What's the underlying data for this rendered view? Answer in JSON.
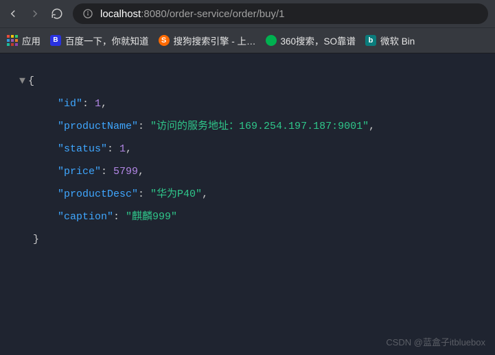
{
  "url": {
    "host": "localhost",
    "rest": ":8080/order-service/order/buy/1"
  },
  "bookmarks": {
    "apps": "应用",
    "baidu": "百度一下，你就知道",
    "sogou": "搜狗搜索引擎 - 上…",
    "d360": "360搜索，SO靠谱",
    "bing": "微软 Bin"
  },
  "json": {
    "keys": {
      "id": "\"id\"",
      "productName": "\"productName\"",
      "status": "\"status\"",
      "price": "\"price\"",
      "productDesc": "\"productDesc\"",
      "caption": "\"caption\""
    },
    "values": {
      "id": "1",
      "productName": "\"访问的服务地址：169.254.197.187:9001\"",
      "status": "1",
      "price": "5799",
      "productDesc": "\"华为P40\"",
      "caption": "\"麒麟999\""
    }
  },
  "watermark": "CSDN @蓝盒子itbluebox"
}
